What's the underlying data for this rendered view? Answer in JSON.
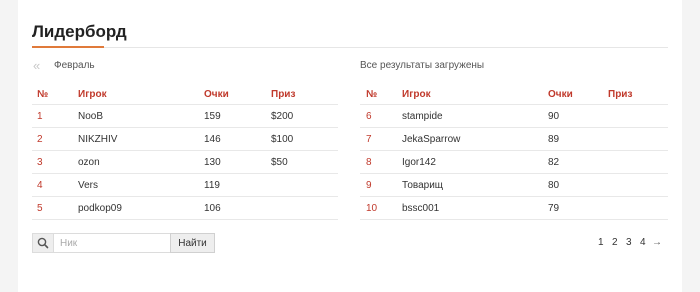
{
  "page_title": "Лидерборд",
  "nav": {
    "prev_icon": "double-chevron-left-icon",
    "month": "Февраль",
    "status_text": "Все результаты загружены"
  },
  "table_headers": {
    "rank": "№",
    "player": "Игрок",
    "points": "Очки",
    "prize": "Приз"
  },
  "left_rows": [
    {
      "rank": "1",
      "player": "NooB",
      "points": "159",
      "prize": "$200"
    },
    {
      "rank": "2",
      "player": "NIKZHIV",
      "points": "146",
      "prize": "$100"
    },
    {
      "rank": "3",
      "player": "ozon",
      "points": "130",
      "prize": "$50"
    },
    {
      "rank": "4",
      "player": "Vers",
      "points": "119",
      "prize": ""
    },
    {
      "rank": "5",
      "player": "podkop09",
      "points": "106",
      "prize": ""
    }
  ],
  "right_rows": [
    {
      "rank": "6",
      "player": "stampide",
      "points": "90",
      "prize": ""
    },
    {
      "rank": "7",
      "player": "JekaSparrow",
      "points": "89",
      "prize": ""
    },
    {
      "rank": "8",
      "player": "Igor142",
      "points": "82",
      "prize": ""
    },
    {
      "rank": "9",
      "player": "Товарищ",
      "points": "80",
      "prize": ""
    },
    {
      "rank": "10",
      "player": "bssc001",
      "points": "79",
      "prize": ""
    }
  ],
  "search": {
    "icon": "search-icon",
    "placeholder": "Ник",
    "value": "",
    "button_label": "Найти"
  },
  "pagination": {
    "pages": [
      "1",
      "2",
      "3",
      "4"
    ],
    "active_page": "1",
    "next_icon": "arrow-right-icon",
    "next_glyph": "→"
  },
  "colors": {
    "accent": "#c0392b",
    "underline": "#e07a3a"
  }
}
